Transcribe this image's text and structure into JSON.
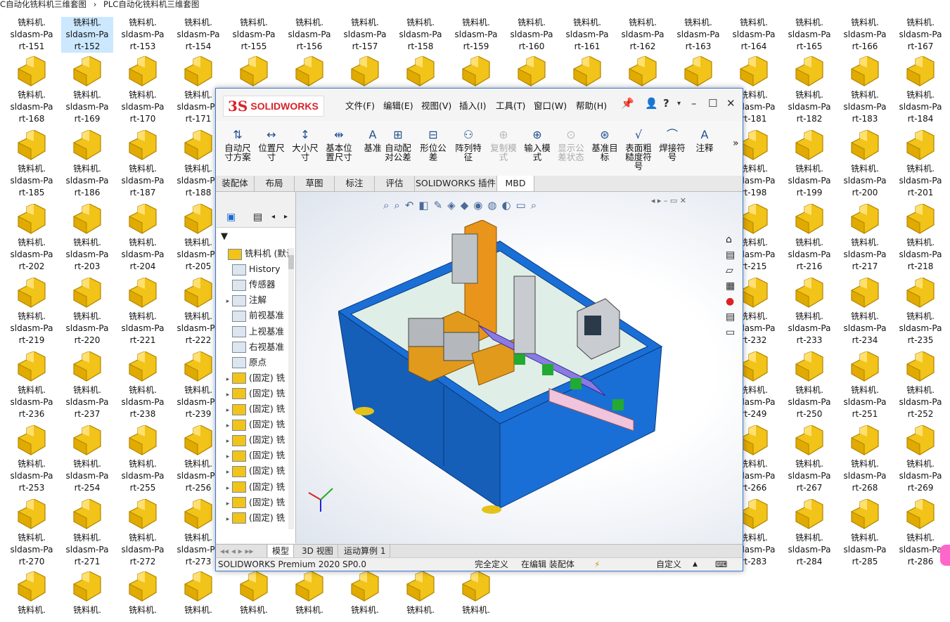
{
  "breadcrumb": [
    "C自动化铣料机三维套图",
    "›",
    "PLC自动化铣料机三维套图"
  ],
  "files": {
    "prefix": "铣料机.",
    "mid": "sldasm-Pa",
    "row1": [
      "rt-151",
      "rt-152",
      "rt-153",
      "rt-154",
      "rt-155",
      "rt-156",
      "rt-157",
      "rt-158",
      "rt-159",
      "rt-160",
      "rt-161",
      "rt-162",
      "rt-163",
      "rt-164",
      "rt-165",
      "rt-166",
      "rt-167"
    ],
    "row2": [
      "rt-168",
      "rt-169",
      "rt-170",
      "rt-171",
      "",
      "",
      "",
      "",
      "",
      "",
      "",
      "",
      "",
      "rt-181",
      "rt-182",
      "rt-183",
      "rt-184"
    ],
    "row3": [
      "rt-185",
      "rt-186",
      "rt-187",
      "rt-188",
      "",
      "",
      "",
      "",
      "",
      "",
      "",
      "",
      "",
      "rt-198",
      "rt-199",
      "rt-200",
      "rt-201"
    ],
    "row4": [
      "rt-202",
      "rt-203",
      "rt-204",
      "rt-205",
      "",
      "",
      "",
      "",
      "",
      "",
      "",
      "",
      "",
      "rt-215",
      "rt-216",
      "rt-217",
      "rt-218"
    ],
    "row5": [
      "rt-219",
      "rt-220",
      "rt-221",
      "rt-222",
      "",
      "",
      "",
      "",
      "",
      "",
      "",
      "",
      "",
      "rt-232",
      "rt-233",
      "rt-234",
      "rt-235"
    ],
    "row6": [
      "rt-236",
      "rt-237",
      "rt-238",
      "rt-239",
      "",
      "",
      "",
      "",
      "",
      "",
      "",
      "",
      "",
      "rt-249",
      "rt-250",
      "rt-251",
      "rt-252"
    ],
    "row7": [
      "rt-253",
      "rt-254",
      "rt-255",
      "rt-256",
      "",
      "",
      "",
      "",
      "",
      "",
      "",
      "",
      "",
      "rt-266",
      "rt-267",
      "rt-268",
      "rt-269"
    ],
    "row8": [
      "rt-270",
      "rt-271",
      "rt-272",
      "rt-273",
      "",
      "",
      "",
      "",
      "",
      "",
      "",
      "",
      "",
      "rt-283",
      "rt-284",
      "rt-285",
      "rt-286"
    ]
  },
  "sw": {
    "logo_ds": "3S",
    "logo_name": "SOLIDWORKS",
    "menus": [
      "文件(F)",
      "编辑(E)",
      "视图(V)",
      "插入(I)",
      "工具(T)",
      "窗口(W)",
      "帮助(H)"
    ],
    "toolbar": [
      "自动尺\n寸方案",
      "位置尺\n寸",
      "大小尺\n寸",
      "基本位\n置尺寸",
      "基准",
      "自动配\n对公差",
      "形位公\n差",
      "阵列特\n征",
      "复制模\n式",
      "输入模\n式",
      "显示公\n差状态",
      "基准目\n标",
      "表面粗\n糙度符\n号",
      "焊接符\n号",
      "注释"
    ],
    "tabs": [
      "装配体",
      "布局",
      "草图",
      "标注",
      "评估",
      "SOLIDWORKS 插件",
      "MBD"
    ],
    "tree": [
      "铣料机 (默认",
      "History",
      "传感器",
      "注解",
      "前视基准",
      "上视基准",
      "右视基准",
      "原点",
      "(固定) 铣",
      "(固定) 铣",
      "(固定) 铣",
      "(固定) 铣",
      "(固定) 铣",
      "(固定) 铣",
      "(固定) 铣",
      "(固定) 铣",
      "(固定) 铣",
      "(固定) 铣"
    ],
    "bottom_tabs": [
      "模型",
      "3D 视图",
      "运动算例 1"
    ],
    "status": {
      "product": "SOLIDWORKS Premium 2020 SP0.0",
      "state": "完全定义",
      "mode": "在编辑 装配体",
      "units": "自定义"
    }
  }
}
